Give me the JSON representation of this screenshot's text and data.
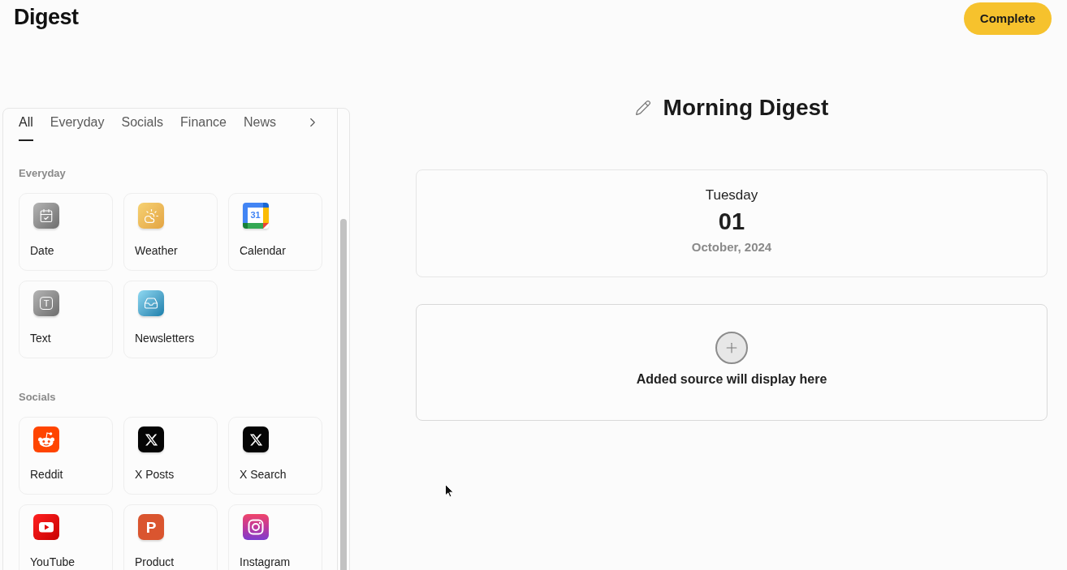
{
  "header": {
    "logo": "Digest",
    "complete_button": "Complete"
  },
  "sidebar": {
    "tabs": [
      {
        "label": "All",
        "selected": true
      },
      {
        "label": "Everyday",
        "selected": false
      },
      {
        "label": "Socials",
        "selected": false
      },
      {
        "label": "Finance",
        "selected": false
      },
      {
        "label": "News",
        "selected": false
      }
    ],
    "sections": [
      {
        "title": "Everyday",
        "items": [
          {
            "label": "Date"
          },
          {
            "label": "Weather"
          },
          {
            "label": "Calendar",
            "icon_text": "31"
          },
          {
            "label": "Text",
            "icon_text": "T"
          },
          {
            "label": "Newsletters"
          }
        ]
      },
      {
        "title": "Socials",
        "items": [
          {
            "label": "Reddit"
          },
          {
            "label": "X Posts"
          },
          {
            "label": "X Search"
          },
          {
            "label": "YouTube"
          },
          {
            "label": "Product",
            "icon_text": "P"
          },
          {
            "label": "Instagram"
          }
        ]
      }
    ]
  },
  "digest": {
    "title": "Morning Digest",
    "date_card": {
      "weekday": "Tuesday",
      "day": "01",
      "month_year": "October, 2024"
    },
    "placeholder": {
      "message": "Added source will display here"
    }
  }
}
